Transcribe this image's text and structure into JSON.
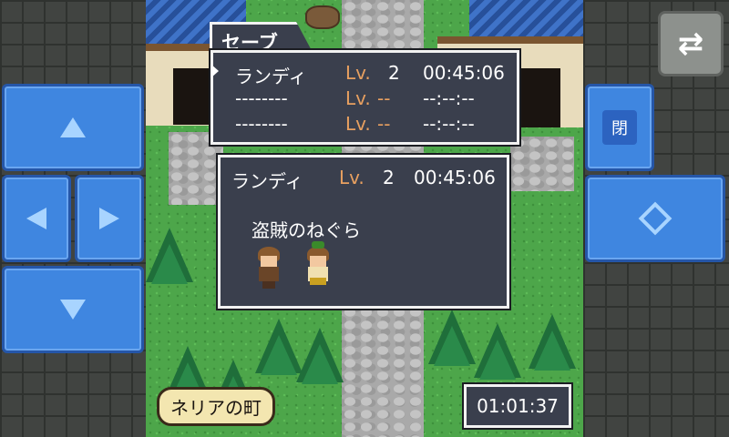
{
  "controls": {
    "close_label": "閉",
    "swap_icon": "⇄",
    "dpad": [
      "up-arrow-icon",
      "left-arrow-icon",
      "right-arrow-icon",
      "down-arrow-icon"
    ],
    "confirm_icon": "diamond-icon"
  },
  "save_menu": {
    "title": "セーブ",
    "slots": [
      {
        "name": "ランディ",
        "lv_label": "Lv.",
        "level": "2",
        "time": "00:45:06"
      },
      {
        "name": "--------",
        "lv_label": "Lv.",
        "level": "--",
        "time": "--:--:--"
      },
      {
        "name": "--------",
        "lv_label": "Lv.",
        "level": "--",
        "time": "--:--:--"
      }
    ]
  },
  "detail": {
    "name": "ランディ",
    "lv_label": "Lv.",
    "level": "2",
    "time": "00:45:06",
    "location": "盗賊のねぐら"
  },
  "hud": {
    "town_name": "ネリアの町",
    "play_time": "01:01:37"
  },
  "colors": {
    "button_blue": "#3f86e0",
    "window_bg": "#3a3f4d",
    "level_orange": "#e8a060"
  }
}
